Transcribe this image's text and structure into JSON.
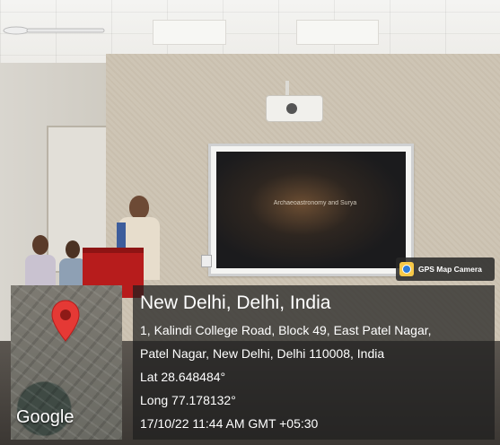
{
  "overlay": {
    "badge_label": "GPS Map Camera",
    "title": "New Delhi, Delhi, India",
    "address_line1": "1, Kalindi College Road, Block 49, East Patel Nagar,",
    "address_line2": "Patel Nagar, New Delhi, Delhi 110008, India",
    "lat": "Lat 28.648484°",
    "long": "Long 77.178132°",
    "datetime": "17/10/22 11:44 AM GMT +05:30",
    "map_brand": "Google"
  },
  "slide": {
    "title": "Archaeoastronomy and Surya",
    "subtitle": ""
  },
  "colors": {
    "podium": "#b71c1c",
    "pin": "#e53935",
    "overlay_bg": "#1e1e1e"
  },
  "icons": [
    "map-pin-icon",
    "gps-camera-icon"
  ]
}
